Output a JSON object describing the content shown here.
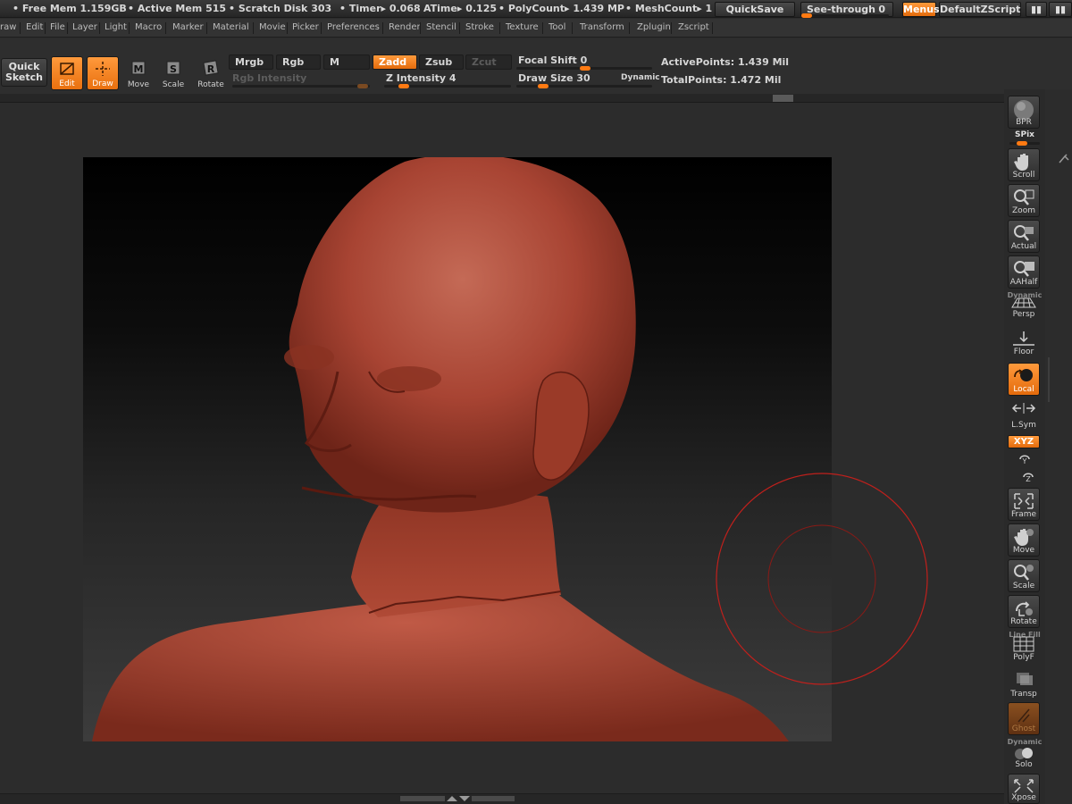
{
  "status": {
    "free_mem": "Free Mem 1.159GB",
    "active_mem": "Active Mem 515",
    "scratch_disk": "Scratch Disk 303",
    "timer": "Timer▸ 0.068",
    "atime": "ATime▸ 0.125",
    "polycount": "PolyCount▸ 1.439 MP",
    "meshcount": "MeshCount▸ 1",
    "quicksave": "QuickSave",
    "see_through": "See-through",
    "see_through_value": "0",
    "menus": "Menus",
    "default_zscript": "DefaultZScript"
  },
  "menubar": [
    "raw",
    "Edit",
    "File",
    "Layer",
    "Light",
    "Macro",
    "Marker",
    "Material",
    "Movie",
    "Picker",
    "Preferences",
    "Render",
    "Stencil",
    "Stroke",
    "Texture",
    "Tool",
    "Transform",
    "Zplugin",
    "Zscript"
  ],
  "toolbar": {
    "quick_sketch": "Quick Sketch",
    "edit": "Edit",
    "draw": "Draw",
    "move": "Move",
    "scale": "Scale",
    "rotate": "Rotate",
    "mrgb": "Mrgb",
    "rgb": "Rgb",
    "m": "M",
    "zadd": "Zadd",
    "zsub": "Zsub",
    "zcut": "Zcut",
    "rgb_intensity": "Rgb  Intensity",
    "z_intensity": "Z Intensity 4",
    "focal_shift": "Focal Shift 0",
    "draw_size": "Draw Size 30",
    "dynamic": "Dynamic",
    "active_points": "ActivePoints: 1.439  Mil",
    "total_points": "TotalPoints: 1.472  Mil"
  },
  "rightshelf": {
    "bpr": "BPR",
    "spix": "SPix",
    "scroll": "Scroll",
    "zoom": "Zoom",
    "actual": "Actual",
    "aahalf": "AAHalf",
    "dynamic_tag": "Dynamic",
    "persp": "Persp",
    "floor": "Floor",
    "local": "Local",
    "lsym": "L.Sym",
    "xyz": "XYZ",
    "frame": "Frame",
    "move": "Move",
    "scale": "Scale",
    "rotate": "Rotate",
    "line_fill": "Line Fill",
    "polyf": "PolyF",
    "transp": "Transp",
    "ghost": "Ghost",
    "dynamic_tag2": "Dynamic",
    "solo": "Solo",
    "xpose": "Xpose"
  },
  "colors": {
    "accent": "#e9700f",
    "clay": "#a63a26",
    "brush_ring": "#c0201c"
  }
}
